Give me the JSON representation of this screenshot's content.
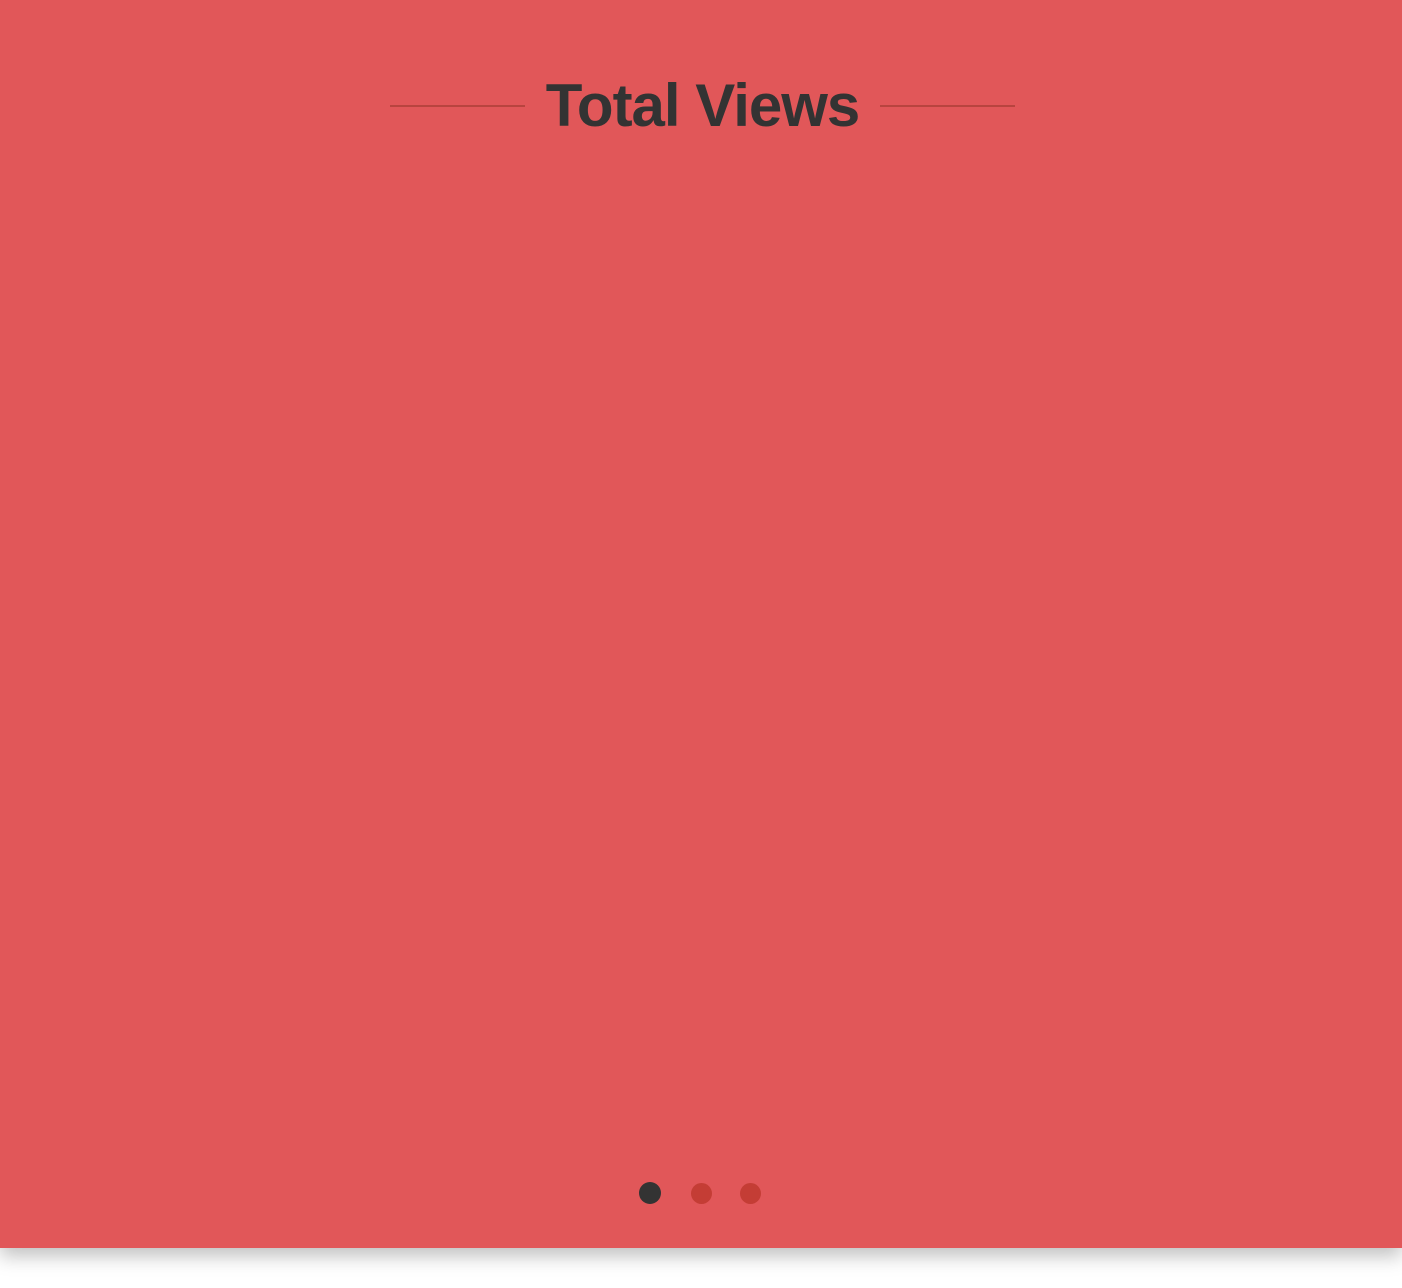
{
  "panel": {
    "title": "Total Views",
    "background_color": "#e15759",
    "title_color": "#333333",
    "rule_color": "#b8443f"
  },
  "pager": {
    "page_count": 3,
    "active_page": 1,
    "active_color": "#333333",
    "inactive_color": "#c43d35"
  }
}
